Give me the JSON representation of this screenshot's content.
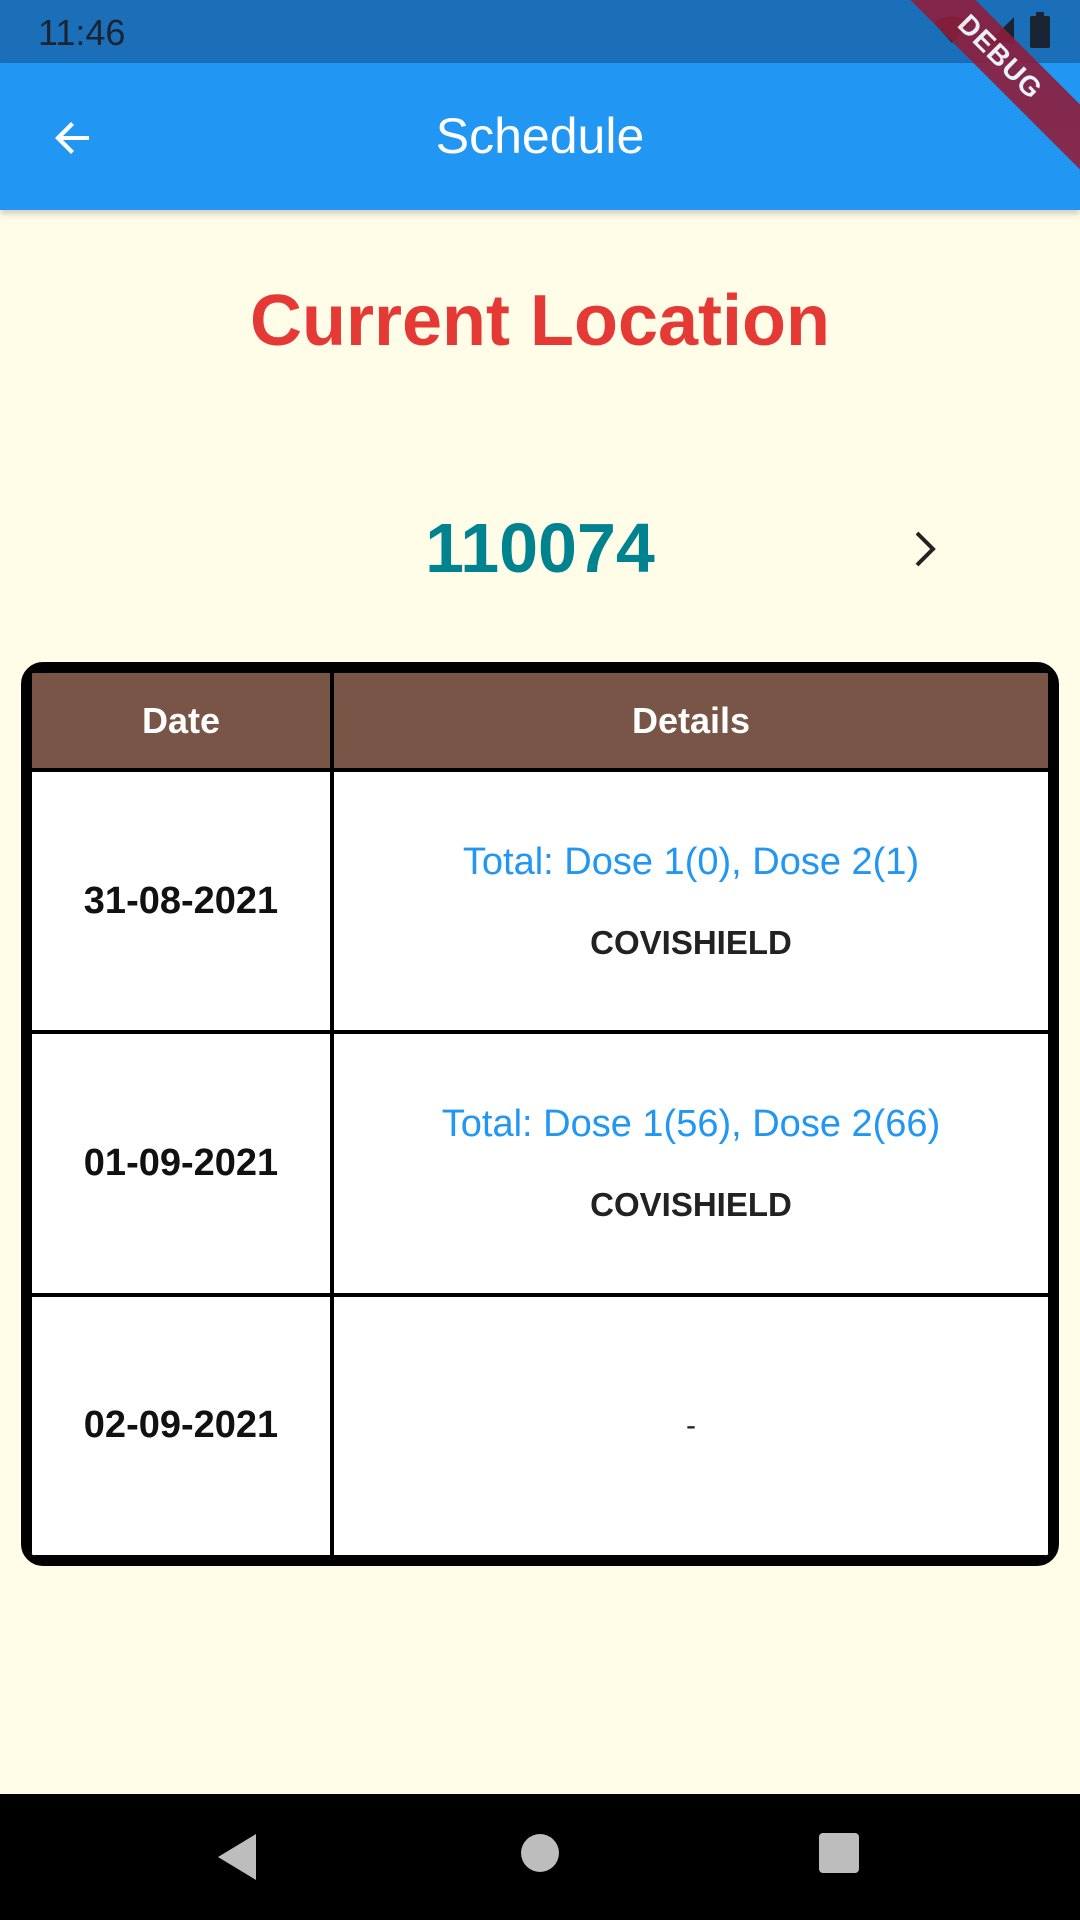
{
  "status_bar": {
    "time": "11:46"
  },
  "app_bar": {
    "title": "Schedule",
    "debug_label": "DEBUG"
  },
  "heading": "Current Location",
  "pincode": "110074",
  "table": {
    "headers": [
      "Date",
      "Details"
    ],
    "rows": [
      {
        "date": "31-08-2021",
        "dose": "Total: Dose 1(0), Dose 2(1)",
        "vaccine": "COVISHIELD"
      },
      {
        "date": "01-09-2021",
        "dose": "Total: Dose 1(56), Dose 2(66)",
        "vaccine": "COVISHIELD"
      },
      {
        "date": "02-09-2021",
        "placeholder": "-"
      }
    ]
  },
  "colors": {
    "app_bar": "#2196f3",
    "heading": "#e53935",
    "pincode": "#00838f",
    "table_header": "#795548",
    "dose_text": "#2196f3",
    "background": "#fffde8"
  }
}
